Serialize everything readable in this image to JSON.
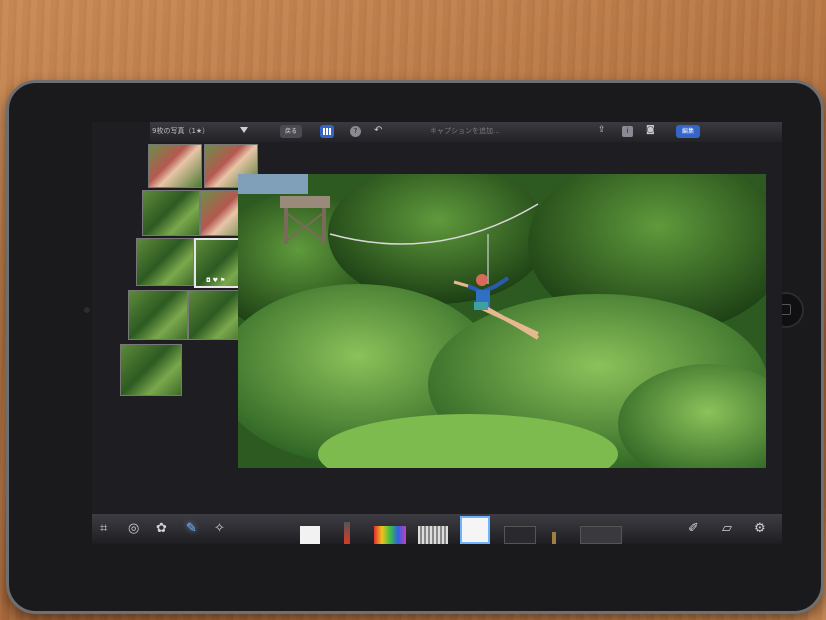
{
  "topbar": {
    "album_title": "9枚の写真（1★）",
    "back_label": "戻る",
    "help_label": "?",
    "caption_placeholder": "キャプションを追加...",
    "info_label": "i",
    "edit_label": "編集"
  },
  "bottombar": {
    "tools": [
      {
        "icon": "crop-icon"
      },
      {
        "icon": "exposure-icon"
      },
      {
        "icon": "color-palette-icon"
      },
      {
        "icon": "brushes-icon",
        "active": true
      },
      {
        "icon": "effects-icon"
      }
    ],
    "brushes": [
      {
        "name": "white-brush",
        "color": "#f2f2f2"
      },
      {
        "name": "red-brush",
        "color": "#d83a2a"
      },
      {
        "name": "rainbow-brush",
        "color": "#e8b030"
      },
      {
        "name": "striped-brush",
        "color": "#cfcfcf"
      },
      {
        "name": "selected-brush",
        "color": "#f5f5f5"
      },
      {
        "name": "dark-brush",
        "color": "#444444"
      },
      {
        "name": "pencil-brush",
        "color": "#a08040"
      },
      {
        "name": "gray-brush",
        "color": "#555555"
      }
    ],
    "right_tools": [
      {
        "icon": "paint-brush-icon"
      },
      {
        "icon": "eraser-icon"
      },
      {
        "icon": "gear-icon"
      }
    ]
  },
  "colors": {
    "accent": "#3565c8",
    "active_tool": "#6fb3ff"
  }
}
